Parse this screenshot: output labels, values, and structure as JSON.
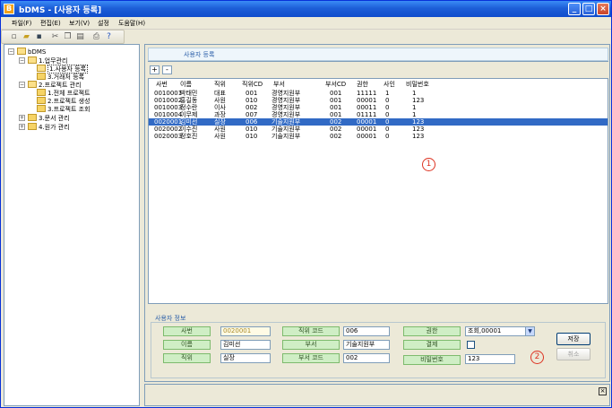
{
  "window": {
    "title": "bDMS - [사용자 등록]",
    "app_icon_text": "B"
  },
  "menu": [
    "파일(F)",
    "편집(E)",
    "보기(V)",
    "설정",
    "도움말(H)"
  ],
  "toolbar_icons": [
    "new-icon",
    "open-icon",
    "save-icon",
    "cut-icon",
    "copy-icon",
    "paste-icon",
    "print-icon",
    "help-icon"
  ],
  "tree": {
    "root": "bDMS",
    "items": [
      "1.업무관리",
      "1.사용자 등록",
      "3.거래처 등록",
      "2.프로젝트 관리",
      "1.전체 프로젝트",
      "2.프로젝트 생성",
      "3.프로젝트 조회",
      "3.문서 관리",
      "4.원가 관리"
    ]
  },
  "header": {
    "title": "사용자 등록",
    "add_label": "+",
    "remove_label": "-"
  },
  "grid": {
    "columns": [
      "사번",
      "이름",
      "직위",
      "직위CD",
      "부서",
      "부서CD",
      "권한",
      "사인",
      "비밀번호"
    ],
    "rows": [
      [
        "0010001",
        "박태민",
        "대표",
        "001",
        "경영지원부",
        "001",
        "11111",
        "1",
        "1"
      ],
      [
        "0010002",
        "홍길동",
        "사원",
        "010",
        "경영지원부",
        "001",
        "00001",
        "0",
        "123"
      ],
      [
        "0010003",
        "정수란",
        "이사",
        "002",
        "경영지원부",
        "001",
        "00011",
        "0",
        "1"
      ],
      [
        "0010004",
        "이무제",
        "과장",
        "007",
        "경영지원부",
        "001",
        "01111",
        "0",
        "1"
      ],
      [
        "0020001",
        "김미선",
        "실장",
        "006",
        "기술지원부",
        "002",
        "00001",
        "0",
        "123"
      ],
      [
        "0020002",
        "이수진",
        "사원",
        "010",
        "기술지원부",
        "002",
        "00001",
        "0",
        "123"
      ],
      [
        "0020003",
        "정호진",
        "사원",
        "010",
        "기술지원부",
        "002",
        "00001",
        "0",
        "123"
      ]
    ],
    "selected_row": 4
  },
  "markers": {
    "one": "1",
    "two": "2"
  },
  "info": {
    "title": "사용자 정보",
    "emp_no_label": "사번",
    "emp_no_value": "0020001",
    "name_label": "이름",
    "name_value": "김미선",
    "position_label": "직위",
    "position_value": "실장",
    "position_code_label": "직위 코드",
    "position_code_value": "006",
    "dept_label": "부서",
    "dept_value": "기술지원부",
    "dept_code_label": "부서 코드",
    "dept_code_value": "002",
    "auth_label": "권한",
    "auth_value": "조회,00001",
    "approval_label": "결제",
    "password_label": "비밀번호",
    "password_value": "123",
    "save_label": "저장",
    "cancel_label": "취소"
  },
  "title_buttons": {
    "min": "_",
    "max": "□",
    "close": "×"
  },
  "bottom": {
    "close": "×"
  }
}
